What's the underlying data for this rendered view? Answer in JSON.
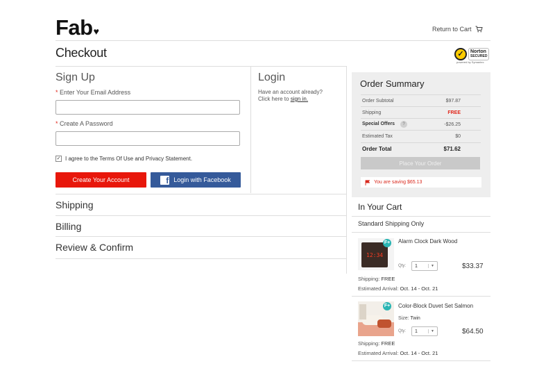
{
  "header": {
    "logo": "Fab",
    "logo_heart": "♥",
    "return_to_cart": "Return to Cart",
    "page_title": "Checkout",
    "norton_brand": "Norton",
    "norton_secured": "SECURED",
    "norton_powered": "powered by Symantec"
  },
  "signup": {
    "title": "Sign Up",
    "email_label": "Enter Your Email Address",
    "email_value": "",
    "password_label": "Create A Password",
    "password_value": "",
    "agree_text": "I agree to the Terms Of Use and Privacy Statement.",
    "agree_checked": true,
    "create_button": "Create Your Account",
    "facebook_button": "Login with Facebook"
  },
  "login": {
    "title": "Login",
    "line1": "Have an account already?",
    "line2_prefix": "Click here to ",
    "sign_in_link": "sign in."
  },
  "steps": [
    "Shipping",
    "Billing",
    "Review & Confirm"
  ],
  "summary": {
    "title": "Order Summary",
    "rows": [
      {
        "label": "Order Subtotal",
        "value": "$97.87"
      },
      {
        "label": "Shipping",
        "value": "FREE"
      },
      {
        "label": "Special Offers",
        "value": "-$26.25"
      },
      {
        "label": "Estimated Tax",
        "value": "$0"
      },
      {
        "label": "Order Total",
        "value": "$71.62"
      }
    ],
    "help_icon": "?",
    "place_order": "Place Your Order",
    "saving": "You are saving $65.13"
  },
  "cart": {
    "title": "In Your Cart",
    "shipping_type": "Standard Shipping Only",
    "items": [
      {
        "name": "Alarm Clock Dark Wood",
        "qty_label": "Qty:",
        "qty": "1",
        "price": "$33.37",
        "shipping_label": "Shipping:",
        "shipping": "FREE",
        "arrival_label": "Estimated Arrival:",
        "arrival": "Oct. 14 - Oct. 21",
        "clock_display": "12:34"
      },
      {
        "name": "Color-Block Duvet Set Salmon",
        "size_label": "Size:",
        "size": "Twin",
        "qty_label": "Qty:",
        "qty": "1",
        "price": "$64.50",
        "shipping_label": "Shipping:",
        "shipping": "FREE",
        "arrival_label": "Estimated Arrival:",
        "arrival": "Oct. 14 - Oct. 21"
      }
    ],
    "badge": "F+"
  },
  "colors": {
    "brand_red": "#e8170b",
    "facebook_blue": "#355a9a",
    "free_red": "#e0281c",
    "badge_teal": "#2ab5b3"
  }
}
